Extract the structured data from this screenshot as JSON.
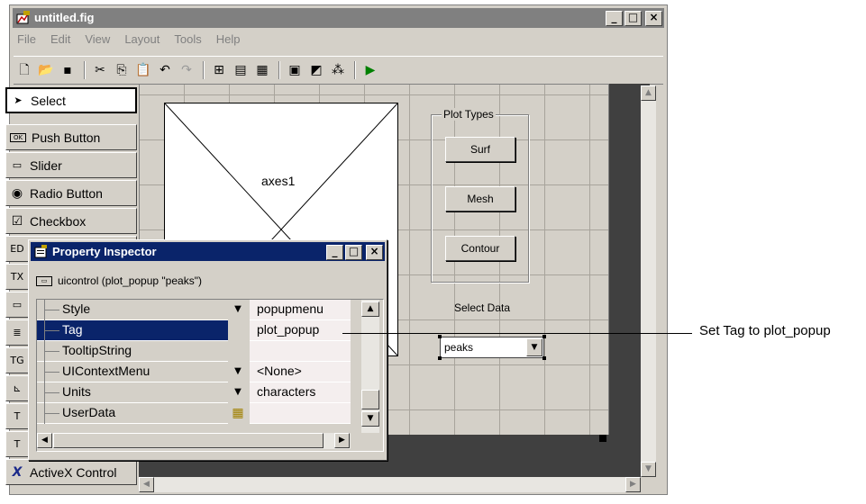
{
  "window": {
    "title": "untitled.fig",
    "min": "_",
    "max": "□",
    "close": "×"
  },
  "menu": [
    "File",
    "Edit",
    "View",
    "Layout",
    "Tools",
    "Help"
  ],
  "toolbar_icons": [
    "new-icon",
    "open-icon",
    "save-icon",
    "cut-icon",
    "copy-icon",
    "paste-icon",
    "undo-icon",
    "redo-icon",
    "align-icon",
    "menu-editor-icon",
    "tab-order-icon",
    "mfile-editor-icon",
    "property-inspector-icon",
    "object-browser-icon",
    "run-icon"
  ],
  "palette": [
    {
      "label": "Select",
      "icon": "▲"
    },
    {
      "label": "Push Button",
      "icon": "OK"
    },
    {
      "label": "Slider",
      "icon": "▭"
    },
    {
      "label": "Radio Button",
      "icon": "◉"
    },
    {
      "label": "Checkbox",
      "icon": "☑"
    },
    {
      "label": "ActiveX Control",
      "icon": "X"
    }
  ],
  "layout": {
    "axes_label": "axes1",
    "group_title": "Plot Types",
    "buttons": [
      "Surf",
      "Mesh",
      "Contour"
    ],
    "select_label": "Select Data",
    "popup_value": "peaks"
  },
  "inspector": {
    "title": "Property Inspector",
    "subtitle": "uicontrol (plot_popup \"peaks\")",
    "rows": [
      {
        "name": "Style",
        "value": "popupmenu"
      },
      {
        "name": "Tag",
        "value": "plot_popup"
      },
      {
        "name": "TooltipString",
        "value": ""
      },
      {
        "name": "UIContextMenu",
        "value": "<None>"
      },
      {
        "name": "Units",
        "value": "characters"
      },
      {
        "name": "UserData",
        "value": ""
      }
    ]
  },
  "callout": "Set Tag to plot_popup"
}
